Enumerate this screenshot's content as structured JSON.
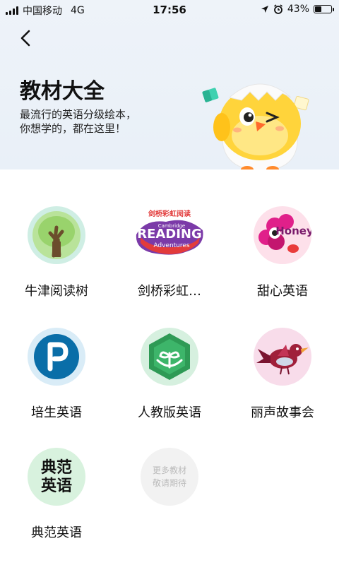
{
  "status_bar": {
    "carrier": "中国移动",
    "network": "4G",
    "time": "17:56",
    "battery_percent": "43%",
    "battery_level": 0.43
  },
  "header": {
    "title": "教材大全",
    "subtitle_line1": "最流行的英语分级绘本，",
    "subtitle_line2": "你想学的，都在这里！"
  },
  "textbooks": [
    {
      "label": "牛津阅读树",
      "icon": "oxford-tree-icon"
    },
    {
      "label": "剑桥彩虹…",
      "icon": "cambridge-reading-adventures-icon"
    },
    {
      "label": "甜心英语",
      "icon": "honey-flower-icon"
    },
    {
      "label": "培生英语",
      "icon": "pearson-logo-icon"
    },
    {
      "label": "人教版英语",
      "icon": "pep-sprout-icon"
    },
    {
      "label": "丽声故事会",
      "icon": "bird-icon"
    },
    {
      "label": "典范英语",
      "icon": "dianfan-english-icon"
    }
  ],
  "more": {
    "line1": "更多教材",
    "line2": "敬请期待"
  },
  "icon_text": {
    "cambridge_top": "剑桥彩虹阅读",
    "cambridge_small": "Cambridge",
    "cambridge_main": "READING",
    "cambridge_sub": "Adventures",
    "honey": "Honey",
    "dianfan_top": "典范",
    "dianfan_bottom": "英语"
  },
  "colors": {
    "hero_bg": "#eef3f9",
    "mascot_yellow": "#ffd43b",
    "pearson_blue": "#0a6ea8"
  }
}
